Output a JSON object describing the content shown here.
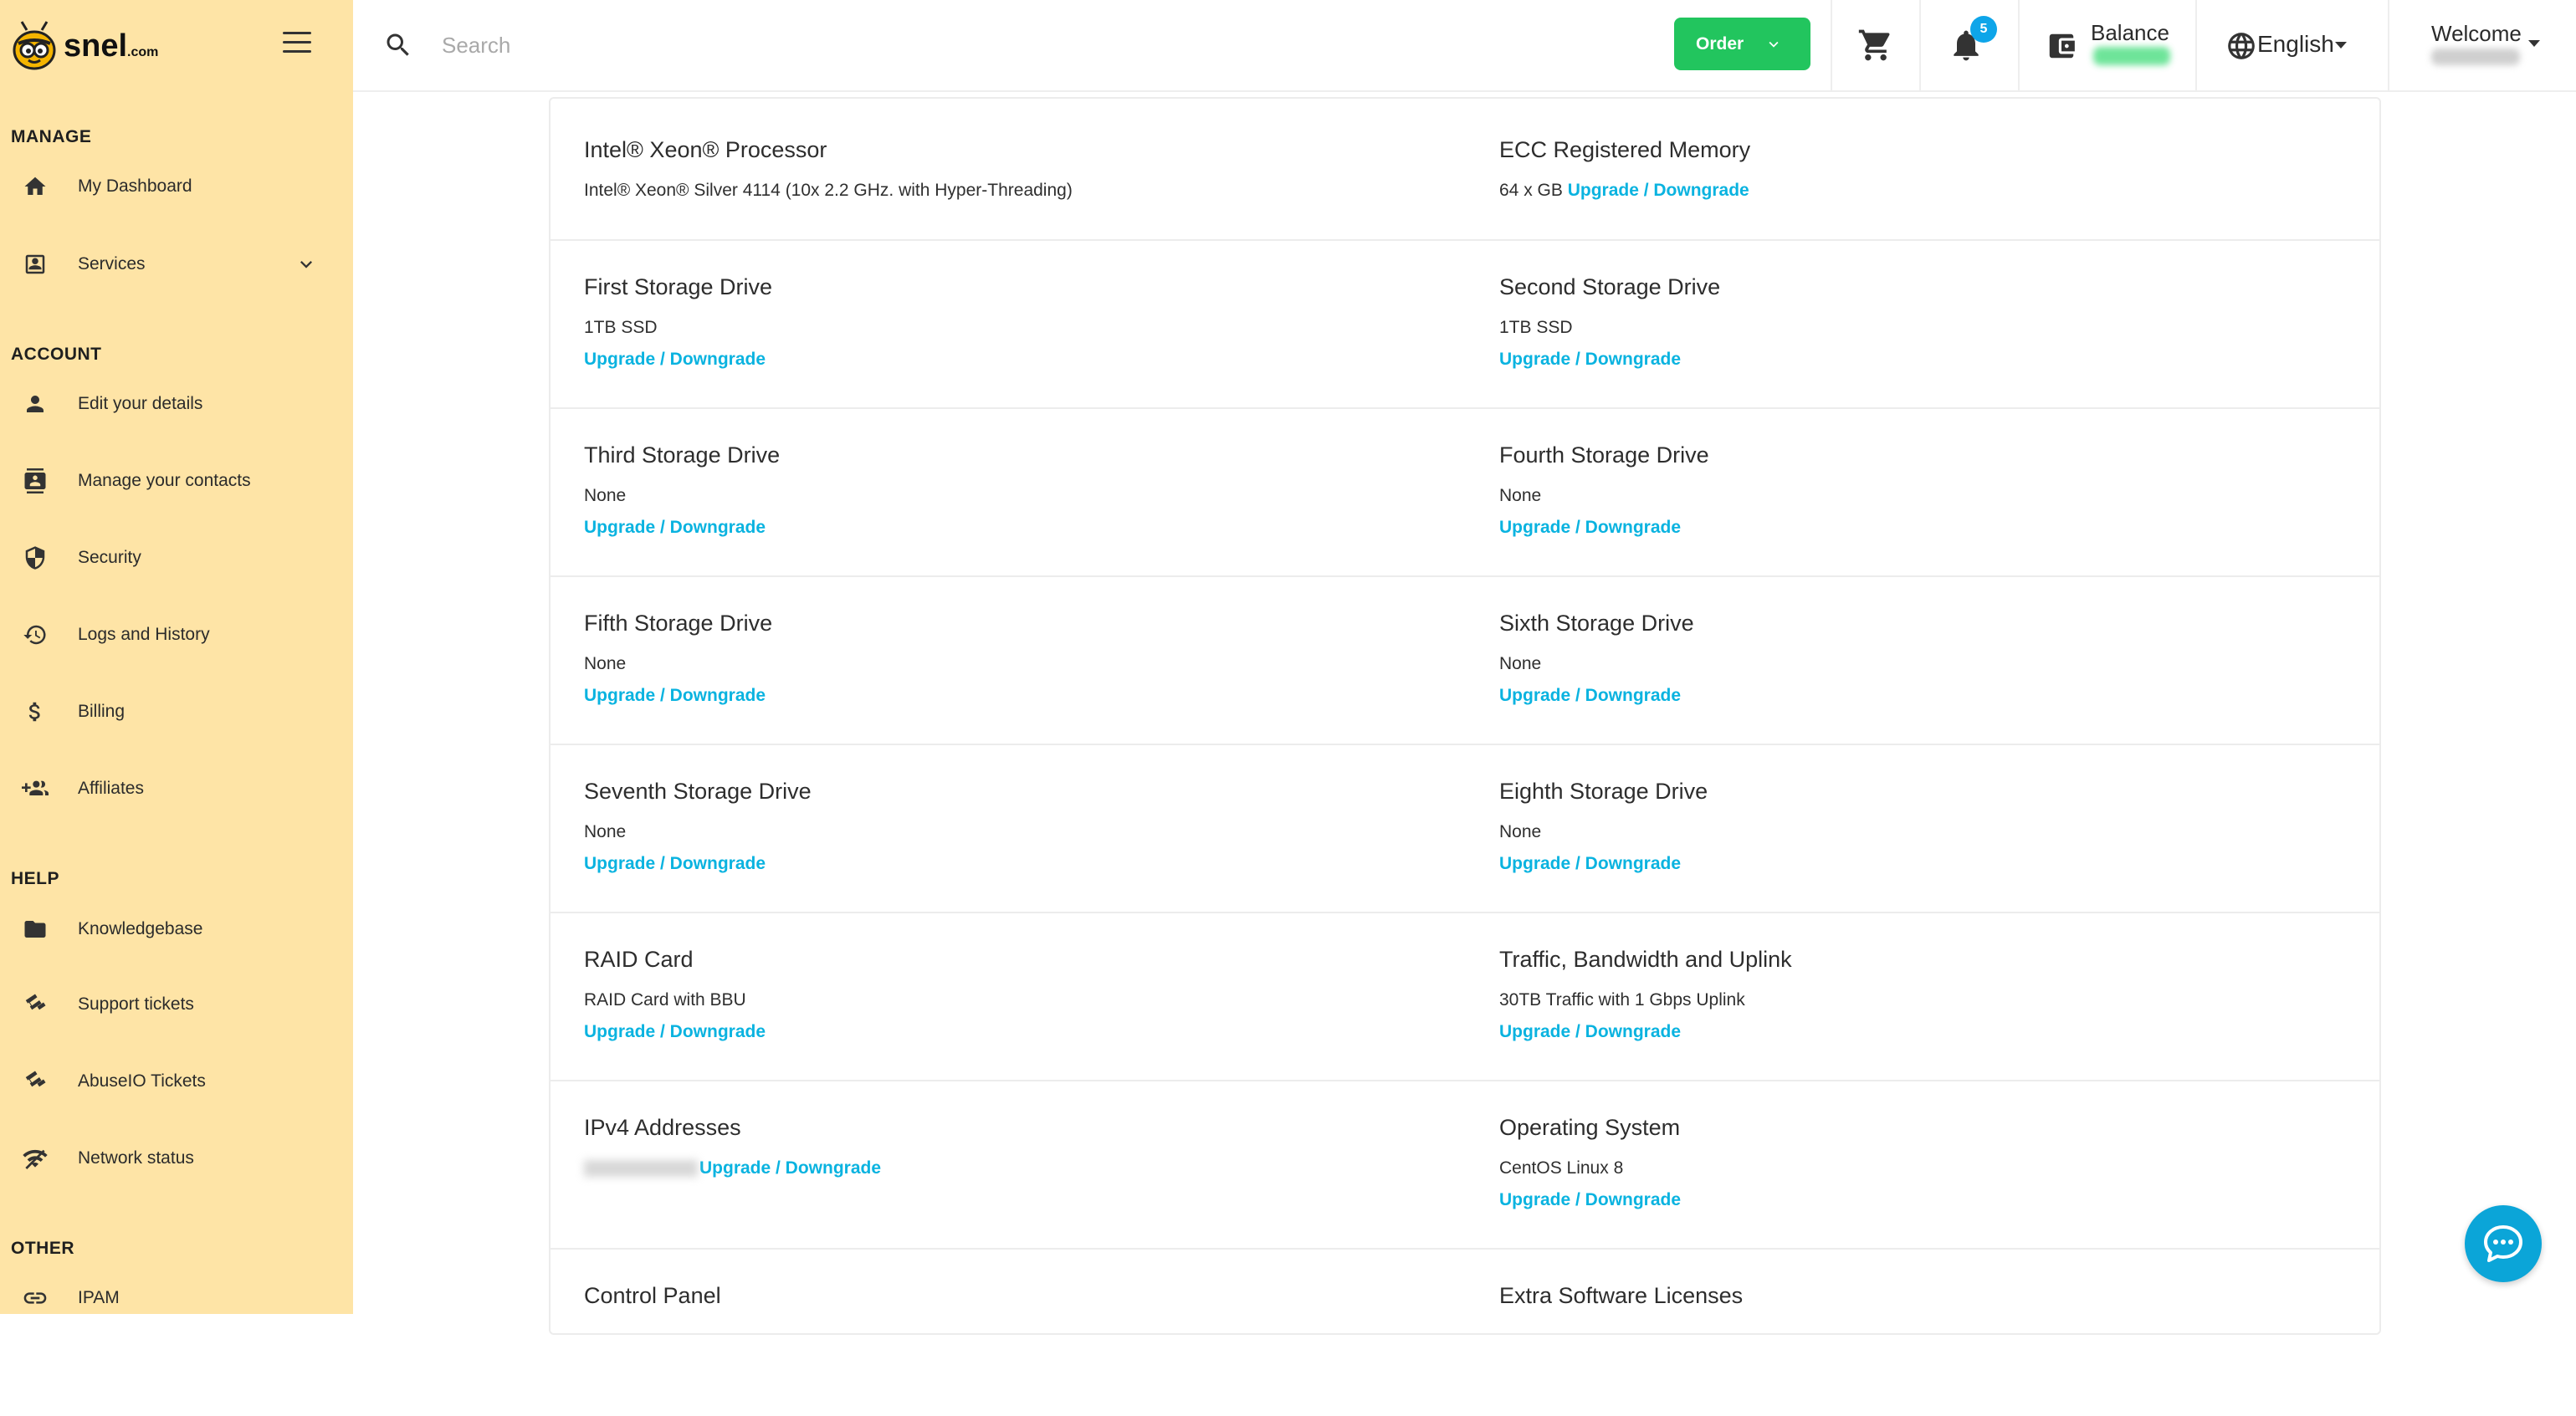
{
  "brand": {
    "name": "snel",
    "suffix": ".com"
  },
  "sidebar": {
    "sections": [
      {
        "title": "MANAGE"
      },
      {
        "title": "ACCOUNT"
      },
      {
        "title": "HELP"
      },
      {
        "title": "OTHER"
      }
    ],
    "items": [
      {
        "label": "My Dashboard",
        "icon": "home-icon"
      },
      {
        "label": "Services",
        "icon": "services-icon"
      },
      {
        "label": "Edit your details",
        "icon": "user-icon"
      },
      {
        "label": "Manage your contacts",
        "icon": "contacts-icon"
      },
      {
        "label": "Security",
        "icon": "shield-icon"
      },
      {
        "label": "Logs and History",
        "icon": "history-icon"
      },
      {
        "label": "Billing",
        "icon": "dollar-icon"
      },
      {
        "label": "Affiliates",
        "icon": "group-add-icon"
      },
      {
        "label": "Knowledgebase",
        "icon": "folder-icon"
      },
      {
        "label": "Support tickets",
        "icon": "ticket-icon"
      },
      {
        "label": "AbuseIO Tickets",
        "icon": "ticket-icon"
      },
      {
        "label": "Network status",
        "icon": "wifi-icon"
      },
      {
        "label": "IPAM",
        "icon": "link-icon"
      }
    ]
  },
  "header": {
    "search_placeholder": "Search",
    "order_label": "Order",
    "notification_count": "5",
    "balance_label": "Balance",
    "language": "English",
    "welcome_label": "Welcome"
  },
  "specs": {
    "upgrade_label": "Upgrade / Downgrade",
    "rows": [
      {
        "left": {
          "title": "Intel® Xeon® Processor",
          "value": "Intel® Xeon® Silver 4114 (10x 2.2 GHz. with Hyper-Threading)"
        },
        "right": {
          "title": "ECC Registered Memory",
          "value": "64 x GB "
        }
      },
      {
        "left": {
          "title": "First Storage Drive",
          "value": "1TB SSD"
        },
        "right": {
          "title": "Second Storage Drive",
          "value": "1TB SSD"
        }
      },
      {
        "left": {
          "title": "Third Storage Drive",
          "value": "None"
        },
        "right": {
          "title": "Fourth Storage Drive",
          "value": "None"
        }
      },
      {
        "left": {
          "title": "Fifth Storage Drive",
          "value": "None"
        },
        "right": {
          "title": "Sixth Storage Drive",
          "value": "None"
        }
      },
      {
        "left": {
          "title": "Seventh Storage Drive",
          "value": "None"
        },
        "right": {
          "title": "Eighth Storage Drive",
          "value": "None"
        }
      },
      {
        "left": {
          "title": "RAID Card",
          "value": "RAID Card with BBU"
        },
        "right": {
          "title": "Traffic, Bandwidth and Uplink",
          "value": "30TB Traffic with 1 Gbps Uplink"
        }
      },
      {
        "left": {
          "title": "IPv4 Addresses",
          "value": ""
        },
        "right": {
          "title": "Operating System",
          "value": "CentOS Linux 8"
        }
      },
      {
        "left": {
          "title": "Control Panel",
          "value": ""
        },
        "right": {
          "title": "Extra Software Licenses",
          "value": ""
        }
      }
    ]
  },
  "colors": {
    "sidebar_bg": "#fee4a6",
    "accent_link": "#0ab3e0",
    "order_button": "#22c55e",
    "badge": "#0ea5e9",
    "chat_button": "#0ba5d8"
  }
}
